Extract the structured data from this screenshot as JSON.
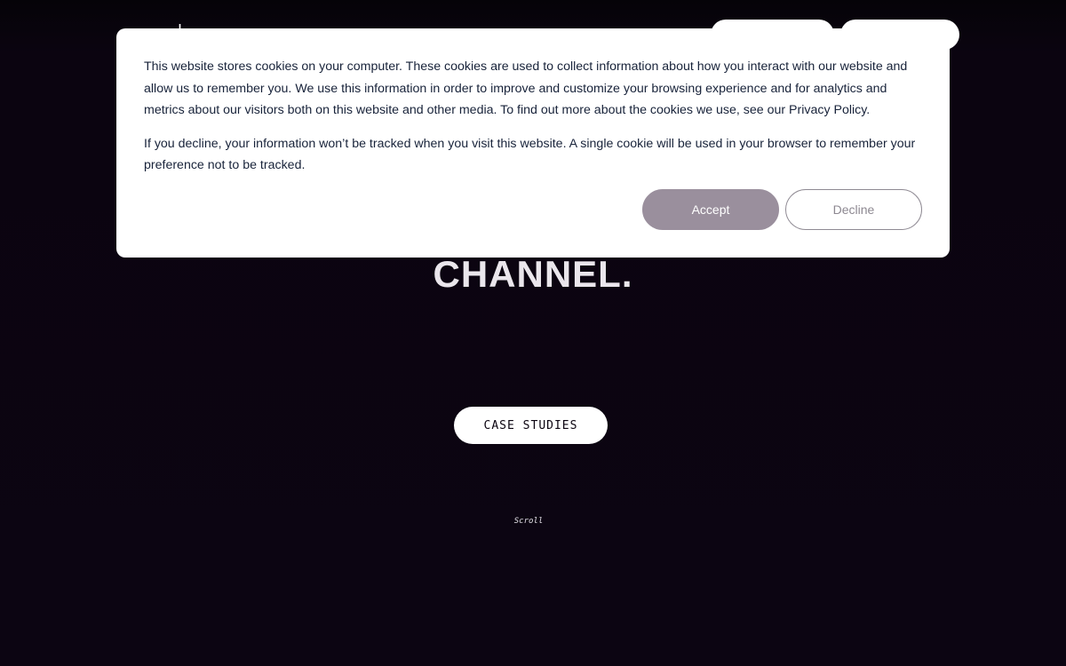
{
  "nav": {
    "logo_glyph": "ı",
    "pill_one_label": "",
    "pill_two_label": ""
  },
  "hero": {
    "headline": "CHANNEL.",
    "case_studies_label": "CASE STUDIES",
    "scroll_label": "Scroll"
  },
  "cookie_banner": {
    "paragraph_1": "This website stores cookies on your computer. These cookies are used to collect information about how you interact with our website and allow us to remember you. We use this information in order to improve and customize your browsing experience and for analytics and metrics about our visitors both on this website and other media. To find out more about the cookies we use, see our Privacy Policy.",
    "paragraph_2": "If you decline, your information won’t be tracked when you visit this website. A single cookie will be used in your browser to remember your preference not to be tracked.",
    "accept_label": "Accept",
    "decline_label": "Decline"
  },
  "colors": {
    "background": "#0c0512",
    "accept_button": "#9a8f9d",
    "banner_text": "#18233a"
  }
}
